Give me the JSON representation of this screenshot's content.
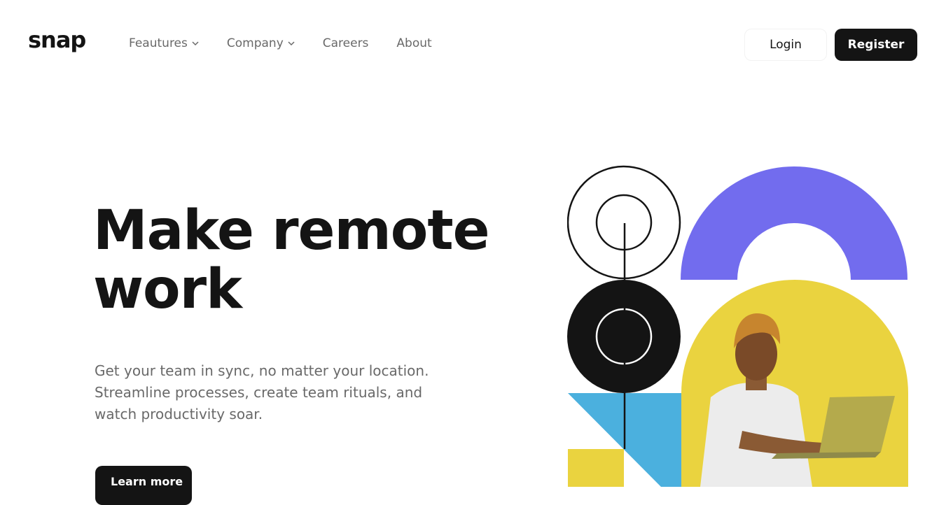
{
  "brand": {
    "logo": "snap"
  },
  "nav": {
    "items": [
      {
        "label": "Feautures",
        "has_dropdown": true
      },
      {
        "label": "Company",
        "has_dropdown": true
      },
      {
        "label": "Careers",
        "has_dropdown": false
      },
      {
        "label": "About",
        "has_dropdown": false
      }
    ]
  },
  "auth": {
    "login_label": "Login",
    "register_label": "Register"
  },
  "hero": {
    "headline_line1": "Make remote",
    "headline_line2": "work",
    "subtitle_line1": "Get your team in sync, no matter your location.",
    "subtitle_line2": "Streamline processes, create team rituals, and",
    "subtitle_line3": "watch productivity soar.",
    "cta_label": "Learn more"
  },
  "colors": {
    "text_dark": "#141414",
    "text_grey": "#696969",
    "purple": "#726cee",
    "yellow": "#ead33f",
    "blue": "#4bb0de",
    "white": "#ffffff"
  },
  "icons": [
    "chevron-down-icon",
    "target-rings-icon",
    "purple-arch-shape",
    "black-circle-shape",
    "blue-triangle-shape",
    "yellow-square-shape",
    "person-with-laptop-photo"
  ]
}
